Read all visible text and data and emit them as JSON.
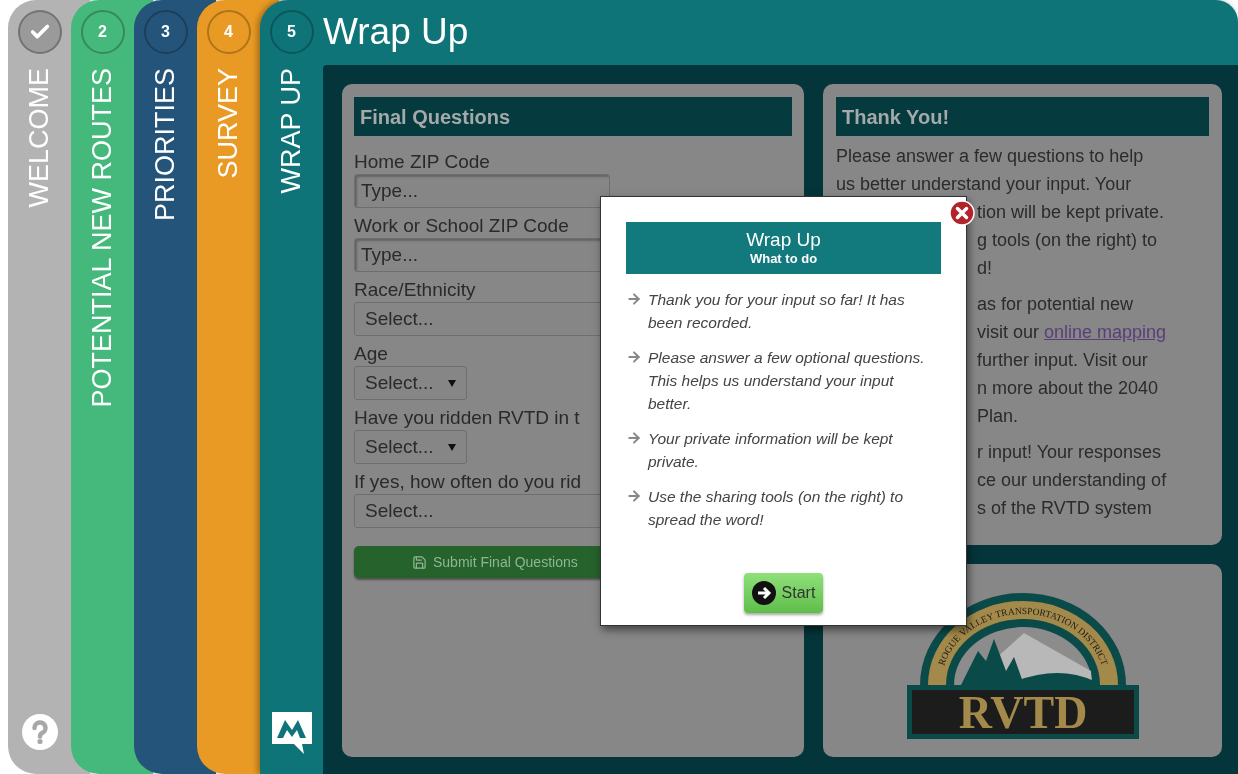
{
  "tabs": [
    {
      "label": "WELCOME",
      "completed": true,
      "selected": false,
      "color": "#b3b3b3"
    },
    {
      "number": "2",
      "label": "POTENTIAL NEW ROUTES",
      "completed": false,
      "selected": false,
      "color": "#45b97c"
    },
    {
      "number": "3",
      "label": "PRIORITIES",
      "completed": false,
      "selected": false,
      "color": "#245479"
    },
    {
      "number": "4",
      "label": "SURVEY",
      "completed": false,
      "selected": false,
      "color": "#e89a24"
    },
    {
      "number": "5",
      "label": "WRAP UP",
      "completed": false,
      "selected": true,
      "color": "#0e7478"
    }
  ],
  "page_title": "Wrap Up",
  "final_questions": {
    "title": "Final Questions",
    "fields": [
      {
        "label": "Home ZIP Code",
        "kind": "text",
        "placeholder": "Type..."
      },
      {
        "label": "Work or School ZIP Code",
        "kind": "text",
        "placeholder": "Type..."
      },
      {
        "label": "Race/Ethnicity",
        "kind": "wide",
        "value": "Select..."
      },
      {
        "label": "Age",
        "kind": "compact",
        "value": "Select..."
      },
      {
        "label": "Have you ridden RVTD in t",
        "kind": "compact",
        "value": "Select..."
      },
      {
        "label": "If yes, how often do you rid",
        "kind": "wide",
        "value": "Select..."
      }
    ],
    "submit": "Submit Final Questions"
  },
  "thank_you": {
    "title": "Thank You!",
    "paragraphs": [
      {
        "lines": [
          {
            "kind": "full",
            "text": "Please answer a few questions to help"
          },
          {
            "kind": "full",
            "text": "us better understand your input. Your"
          },
          {
            "kind": "cut",
            "text": "tion will be kept private."
          },
          {
            "kind": "cut",
            "text": "g tools (on the right) to"
          },
          {
            "kind": "cut",
            "text": "d!"
          }
        ]
      },
      {
        "lines": [
          {
            "kind": "cut",
            "text": "as for potential new"
          },
          {
            "kind": "cut",
            "text": "visit our ",
            "link": "online mapping"
          },
          {
            "kind": "cut",
            "text": "further input. Visit our"
          },
          {
            "kind": "cut",
            "text": "n more about the 2040"
          },
          {
            "kind": "cut",
            "text": "Plan."
          }
        ]
      },
      {
        "lines": [
          {
            "kind": "cut",
            "text": "r input! Your responses"
          },
          {
            "kind": "cut",
            "text": "ce our understanding of"
          },
          {
            "kind": "cut",
            "text": "s of the RVTD system"
          }
        ]
      }
    ]
  },
  "logo": {
    "arc_text": "ROGUE VALLEY TRANSPORTATION DISTRICT",
    "wordmark": "RVTD"
  },
  "dialog": {
    "title": "Wrap Up",
    "subtitle": "What to do",
    "items": [
      "Thank you for your input so far! It has been recorded.",
      "Please answer a few optional questions. This helps us understand your input better.",
      "Your private information will be kept private.",
      "Use the sharing tools (on the right) to spread the word!"
    ],
    "start": "Start"
  }
}
